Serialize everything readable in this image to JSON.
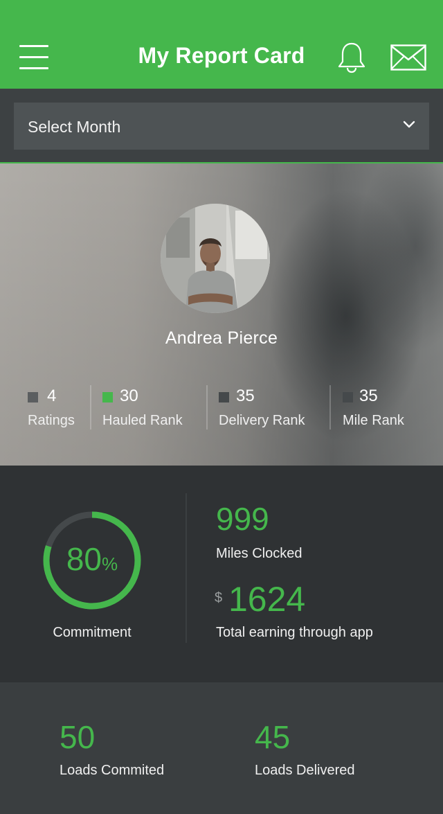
{
  "header": {
    "title": "My Report Card",
    "menu_icon": "hamburger-menu-icon",
    "notification_icon": "bell-icon",
    "message_icon": "envelope-icon"
  },
  "month_select": {
    "label": "Select Month",
    "icon": "chevron-down-icon"
  },
  "profile": {
    "name": "Andrea Pierce",
    "stats": [
      {
        "value": "4",
        "label": "Ratings",
        "color": "#5b5e60"
      },
      {
        "value": "30",
        "label": "Hauled Rank",
        "color": "#45b74c"
      },
      {
        "value": "35",
        "label": "Delivery Rank",
        "color": "#45494b"
      },
      {
        "value": "35",
        "label": "Mile Rank",
        "color": "#45494b"
      }
    ]
  },
  "summary": {
    "commitment": {
      "value": "80",
      "unit": "%",
      "label": "Commitment",
      "fraction": 0.8
    },
    "miles": {
      "value": "999",
      "label": "Miles Clocked"
    },
    "earnings": {
      "currency": "$",
      "value": "1624",
      "label": "Total earning through app"
    }
  },
  "loads": {
    "committed": {
      "value": "50",
      "label": "Loads Commited"
    },
    "delivered": {
      "value": "45",
      "label": "Loads Delivered"
    }
  },
  "colors": {
    "accent": "#45b74c",
    "background": "#2e3133"
  }
}
